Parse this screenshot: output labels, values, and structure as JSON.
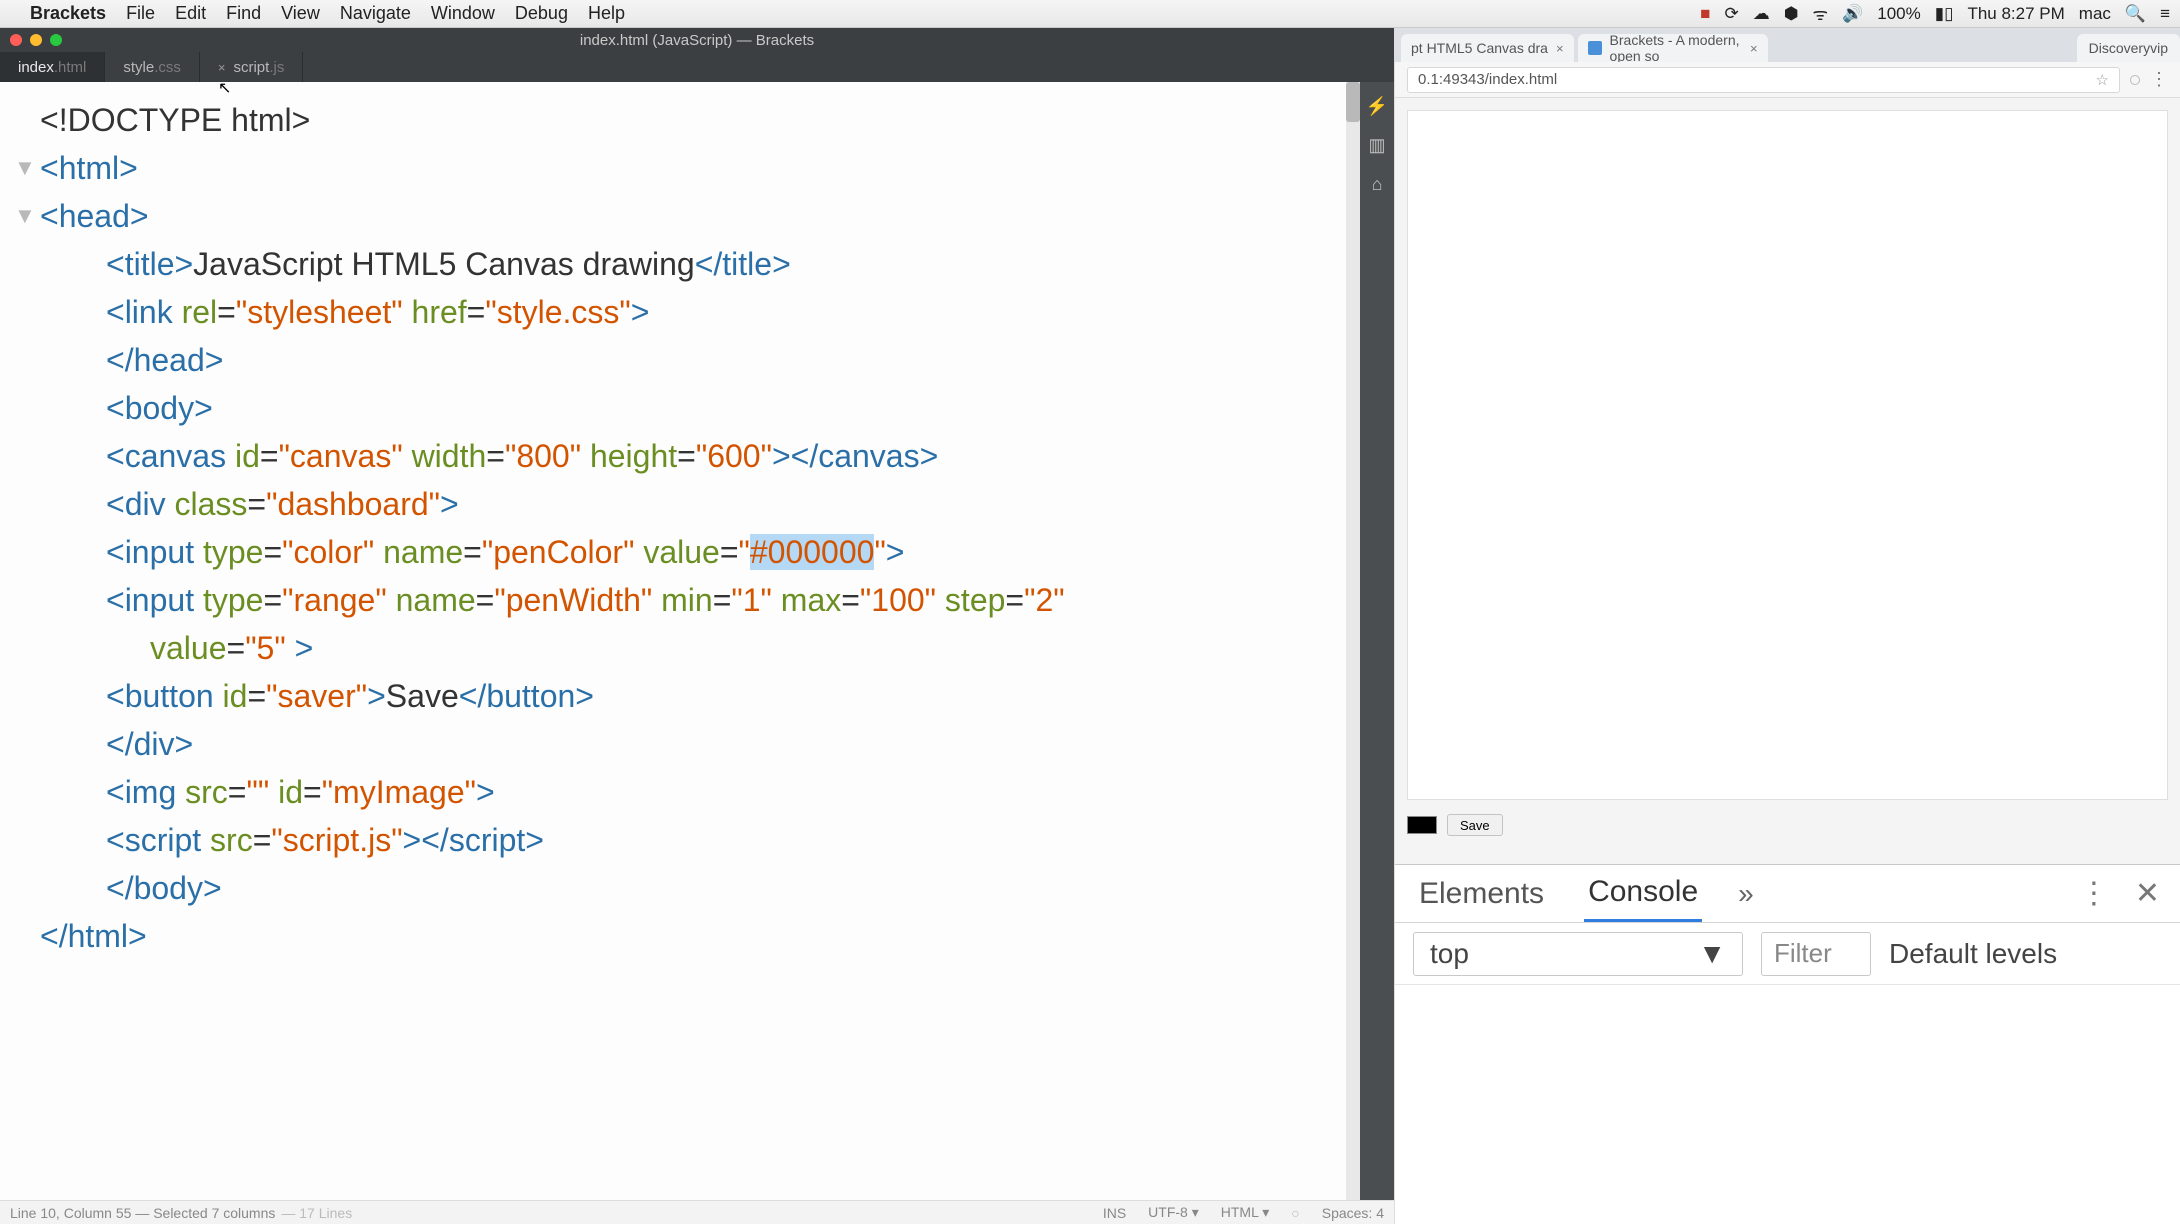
{
  "menubar": {
    "app": "Brackets",
    "items": [
      "File",
      "Edit",
      "Find",
      "View",
      "Navigate",
      "Window",
      "Debug",
      "Help"
    ],
    "battery": "100%",
    "clock": "Thu 8:27 PM",
    "user": "mac"
  },
  "brackets": {
    "window_title": "index.html (JavaScript) — Brackets",
    "tabs": [
      {
        "name": "index",
        "ext": ".html",
        "active": true,
        "closable": false
      },
      {
        "name": "style",
        "ext": ".css",
        "active": false,
        "closable": false
      },
      {
        "name": "script",
        "ext": ".js",
        "active": false,
        "closable": true
      }
    ],
    "status": {
      "cursor": "Line 10, Column 55 — Selected 7 columns",
      "lines": "— 17 Lines",
      "ins": "INS",
      "encoding": "UTF-8",
      "lang": "HTML",
      "spaces": "Spaces: 4"
    }
  },
  "code": {
    "doctype": "<!DOCTYPE html>",
    "html_open": "html",
    "head_open": "head",
    "title_tag": "title",
    "title_text": "JavaScript HTML5 Canvas drawing",
    "link_tag": "link",
    "link_rel_attr": "rel",
    "link_rel_val": "\"stylesheet\"",
    "link_href_attr": "href",
    "link_href_val": "\"style.css\"",
    "head_close": "/head",
    "body_open": "body",
    "canvas_tag": "canvas",
    "canvas_id_attr": "id",
    "canvas_id_val": "\"canvas\"",
    "canvas_w_attr": "width",
    "canvas_w_val": "\"800\"",
    "canvas_h_attr": "height",
    "canvas_h_val": "\"600\"",
    "div_tag": "div",
    "div_class_attr": "class",
    "div_class_val": "\"dashboard\"",
    "input_tag": "input",
    "type_attr": "type",
    "color_val": "\"color\"",
    "name_attr": "name",
    "penColor_val": "\"penColor\"",
    "value_attr": "value",
    "hex_val_q1": "\"",
    "hex_val_sel": "#000000",
    "hex_val_q2": "\"",
    "range_val": "\"range\"",
    "penWidth_val": "\"penWidth\"",
    "min_attr": "min",
    "min_val": "\"1\"",
    "max_attr": "max",
    "max_val": "\"100\"",
    "step_attr": "step",
    "step_val": "\"2\"",
    "value5_val": "\"5\"",
    "button_tag": "button",
    "button_id_val": "\"saver\"",
    "button_text": "Save",
    "div_close": "/div",
    "img_tag": "img",
    "src_attr": "src",
    "src_val": "\"\"",
    "img_id_val": "\"myImage\"",
    "script_tag": "script",
    "script_src_val": "\"script.js\"",
    "body_close": "/body",
    "html_close": "/html"
  },
  "browser": {
    "tabs": [
      {
        "label": "pt HTML5 Canvas dra"
      },
      {
        "label": "Brackets - A modern, open so"
      }
    ],
    "ext_label": "Discoveryvip",
    "url": "0.1:49343/index.html",
    "save_btn": "Save"
  },
  "devtools": {
    "tab_elements": "Elements",
    "tab_console": "Console",
    "more": "»",
    "context": "top",
    "filter_placeholder": "Filter",
    "levels": "Default levels"
  }
}
